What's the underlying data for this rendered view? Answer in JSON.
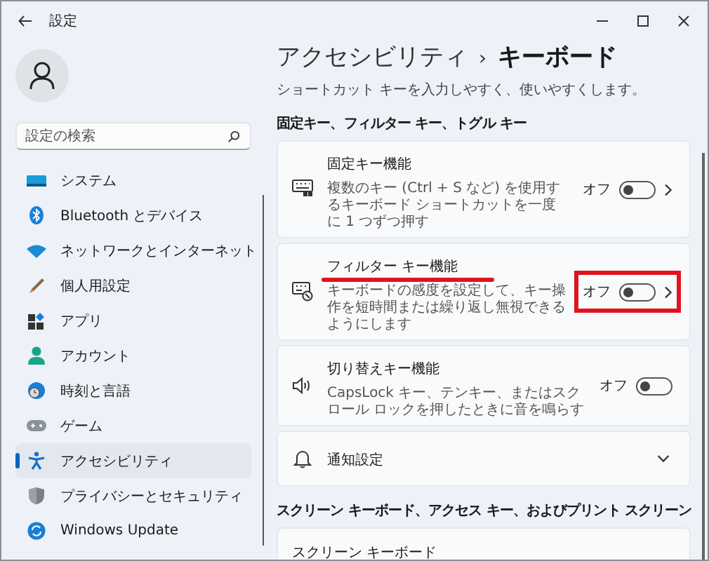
{
  "window": {
    "title": "設定"
  },
  "sidebar": {
    "search": {
      "placeholder": "設定の検索"
    },
    "items": [
      {
        "label": "システム",
        "kind": "system",
        "selected": false
      },
      {
        "label": "Bluetooth とデバイス",
        "kind": "bluetooth",
        "selected": false
      },
      {
        "label": "ネットワークとインターネット",
        "kind": "network",
        "selected": false
      },
      {
        "label": "個人用設定",
        "kind": "personalize",
        "selected": false
      },
      {
        "label": "アプリ",
        "kind": "apps",
        "selected": false
      },
      {
        "label": "アカウント",
        "kind": "account",
        "selected": false
      },
      {
        "label": "時刻と言語",
        "kind": "time",
        "selected": false
      },
      {
        "label": "ゲーム",
        "kind": "game",
        "selected": false
      },
      {
        "label": "アクセシビリティ",
        "kind": "accessibility",
        "selected": true
      },
      {
        "label": "プライバシーとセキュリティ",
        "kind": "privacy",
        "selected": false
      },
      {
        "label": "Windows Update",
        "kind": "update",
        "selected": false
      }
    ]
  },
  "breadcrumb": {
    "parent": "アクセシビリティ",
    "separator": "›",
    "current": "キーボード"
  },
  "subtitle": "ショートカット キーを入力しやすく、使いやすくします。",
  "sections": [
    {
      "heading": "固定キー、フィルター キー、トグル キー",
      "cards": [
        {
          "kind": "sticky",
          "title": "固定キー機能",
          "description": "複数のキー (Ctrl + S など) を使用するキーボード ショートカットを一度に 1 つずつ押す",
          "state_label": "オフ",
          "on": false,
          "chevron": true,
          "highlighted": false
        },
        {
          "kind": "filter",
          "title": "フィルター キー機能",
          "description": "キーボードの感度を設定して、キー操作を短時間または繰り返し無視できるようにします",
          "state_label": "オフ",
          "on": false,
          "chevron": true,
          "highlighted": true
        },
        {
          "kind": "sound",
          "title": "切り替えキー機能",
          "description": "CapsLock キー、テンキー、またはスクロール ロックを押したときに音を鳴らす",
          "state_label": "オフ",
          "on": false,
          "chevron": false,
          "highlighted": false
        },
        {
          "kind": "notify",
          "title": "通知設定",
          "expanded": false
        }
      ]
    },
    {
      "heading": "スクリーン キーボード、アクセス キー、およびプリント スクリーン",
      "cards": [
        {
          "kind": "plain",
          "title": "スクリーン キーボード"
        }
      ]
    }
  ]
}
